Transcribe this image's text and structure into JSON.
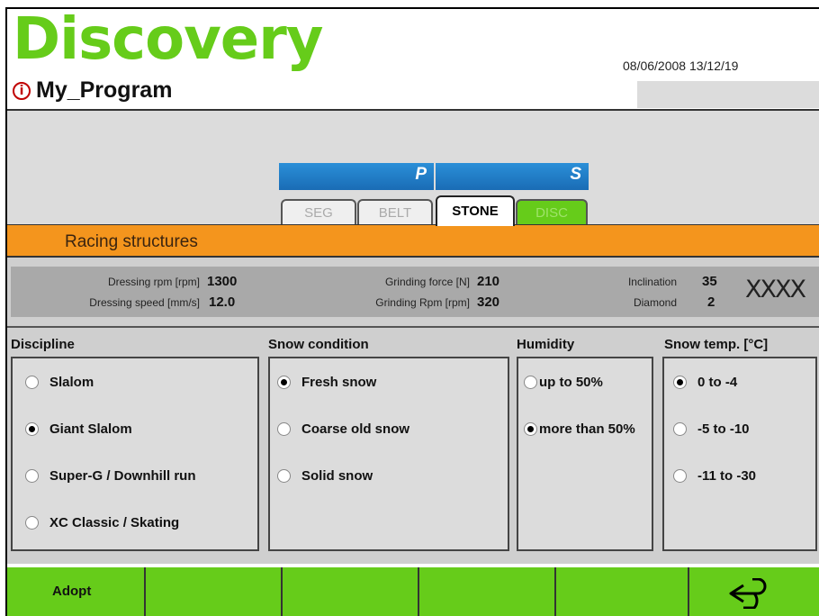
{
  "header": {
    "brand": "Discovery",
    "program_name": "My_Program",
    "warning_glyph": "i",
    "datetime": "08/06/2008 13/12/19"
  },
  "tab_groups": [
    {
      "letter": "P"
    },
    {
      "letter": "S"
    }
  ],
  "tabs": [
    {
      "label": "SEG",
      "state": "disabled"
    },
    {
      "label": "BELT",
      "state": "disabled"
    },
    {
      "label": "STONE",
      "state": "active"
    },
    {
      "label": "DISC",
      "state": "inactive"
    }
  ],
  "section_title": "Racing structures",
  "params": {
    "dressing_rpm": {
      "label": "Dressing rpm [rpm]",
      "value": "1300"
    },
    "dressing_speed": {
      "label": "Dressing speed [mm/s]",
      "value": "12.0"
    },
    "grinding_force": {
      "label": "Grinding force [N]",
      "value": "210"
    },
    "grinding_rpm": {
      "label": "Grinding Rpm [rpm]",
      "value": "320"
    },
    "inclination": {
      "label": "Inclination",
      "value": "35"
    },
    "diamond": {
      "label": "Diamond",
      "value": "2"
    },
    "pattern": "XXXX"
  },
  "groups": {
    "discipline": {
      "title": "Discipline",
      "options": [
        {
          "label": "Slalom",
          "selected": false
        },
        {
          "label": "Giant Slalom",
          "selected": true
        },
        {
          "label": "Super-G / Downhill run",
          "selected": false
        },
        {
          "label": "XC Classic / Skating",
          "selected": false
        }
      ]
    },
    "snow_condition": {
      "title": "Snow condition",
      "options": [
        {
          "label": "Fresh snow",
          "selected": true
        },
        {
          "label": "Coarse old snow",
          "selected": false
        },
        {
          "label": "Solid snow",
          "selected": false
        }
      ]
    },
    "humidity": {
      "title": "Humidity",
      "options": [
        {
          "label": "up to 50%",
          "selected": false
        },
        {
          "label": "more than 50%",
          "selected": true
        }
      ]
    },
    "snow_temp": {
      "title": "Snow temp. [°C]",
      "options": [
        {
          "label": "0 to -4",
          "selected": true
        },
        {
          "label": "-5 to -10",
          "selected": false
        },
        {
          "label": "-11 to -30",
          "selected": false
        }
      ]
    }
  },
  "buttons": {
    "adopt_label": "Adopt",
    "back_icon": "back-arrow-icon"
  },
  "colors": {
    "brand_green": "#66cc1a",
    "section_orange": "#f4951d",
    "tab_blue": "#1a6cb5"
  }
}
